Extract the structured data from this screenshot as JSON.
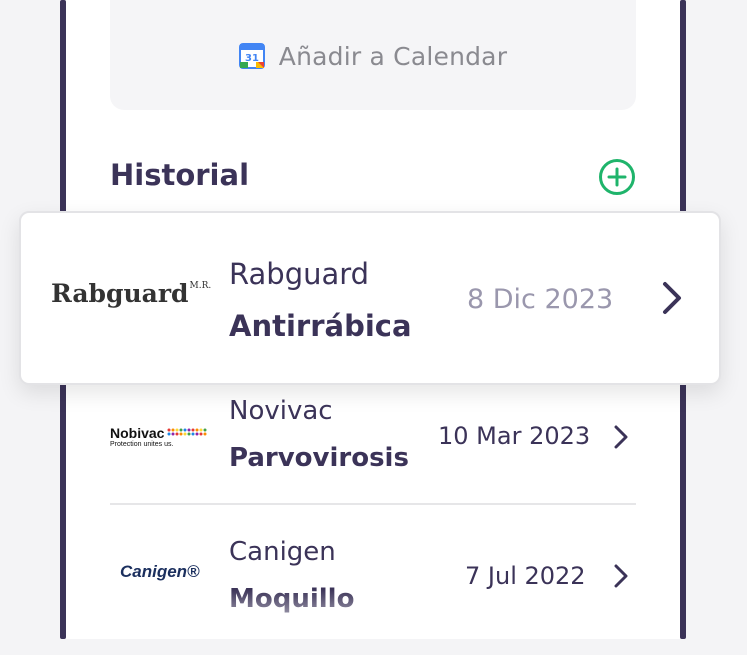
{
  "calendar": {
    "label": "Añadir a Calendar",
    "icon": "google-calendar-icon",
    "icon_day": "31"
  },
  "history": {
    "title": "Historial",
    "add_icon": "plus-circle-icon",
    "items": [
      {
        "brand": "Rabguard",
        "brand_mark": "M.R.",
        "name": "Rabguard",
        "type": "Antirrábica",
        "date": "8 Dic 2023"
      },
      {
        "brand": "Nobivac",
        "brand_tagline": "Protection unites us.",
        "name": "Novivac",
        "type": "Parvovirosis",
        "date": "10 Mar 2023"
      },
      {
        "brand": "Canigen®",
        "name": "Canigen",
        "type": "Moquillo",
        "date": "7 Jul 2022"
      }
    ]
  },
  "colors": {
    "primary": "#3b3358",
    "accent_green": "#1fb46b",
    "muted": "#8a8a90",
    "date_muted": "#9a97ad"
  }
}
